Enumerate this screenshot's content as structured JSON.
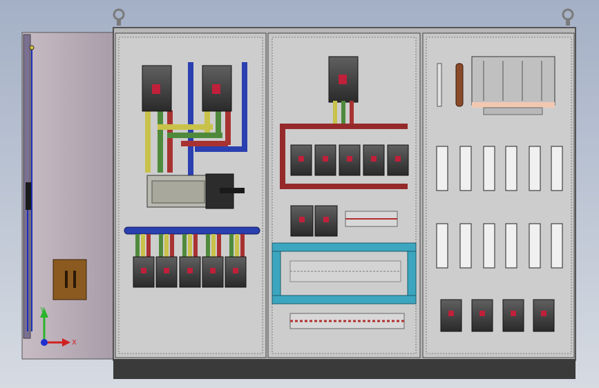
{
  "scene": {
    "background_top": "#a4b0c6",
    "background_bottom": "#d2d8e0",
    "cabinet_color": "#c9c9c9",
    "door_color": "#b4a8b2",
    "plinth_color": "#3a3a3a"
  },
  "busbar_colors": {
    "L1_yellow": "#c8c24a",
    "L2_green": "#4f8a3c",
    "L3_red": "#a83232",
    "N_blue": "#2a3fb0",
    "frame_cyan": "#3ca6c0",
    "frame_red": "#962a2a"
  },
  "triad": {
    "x_label": "X",
    "y_label": "Y"
  },
  "icons": [
    "lifting-eye-icon",
    "axis-triad-icon",
    "door-handle-icon"
  ]
}
